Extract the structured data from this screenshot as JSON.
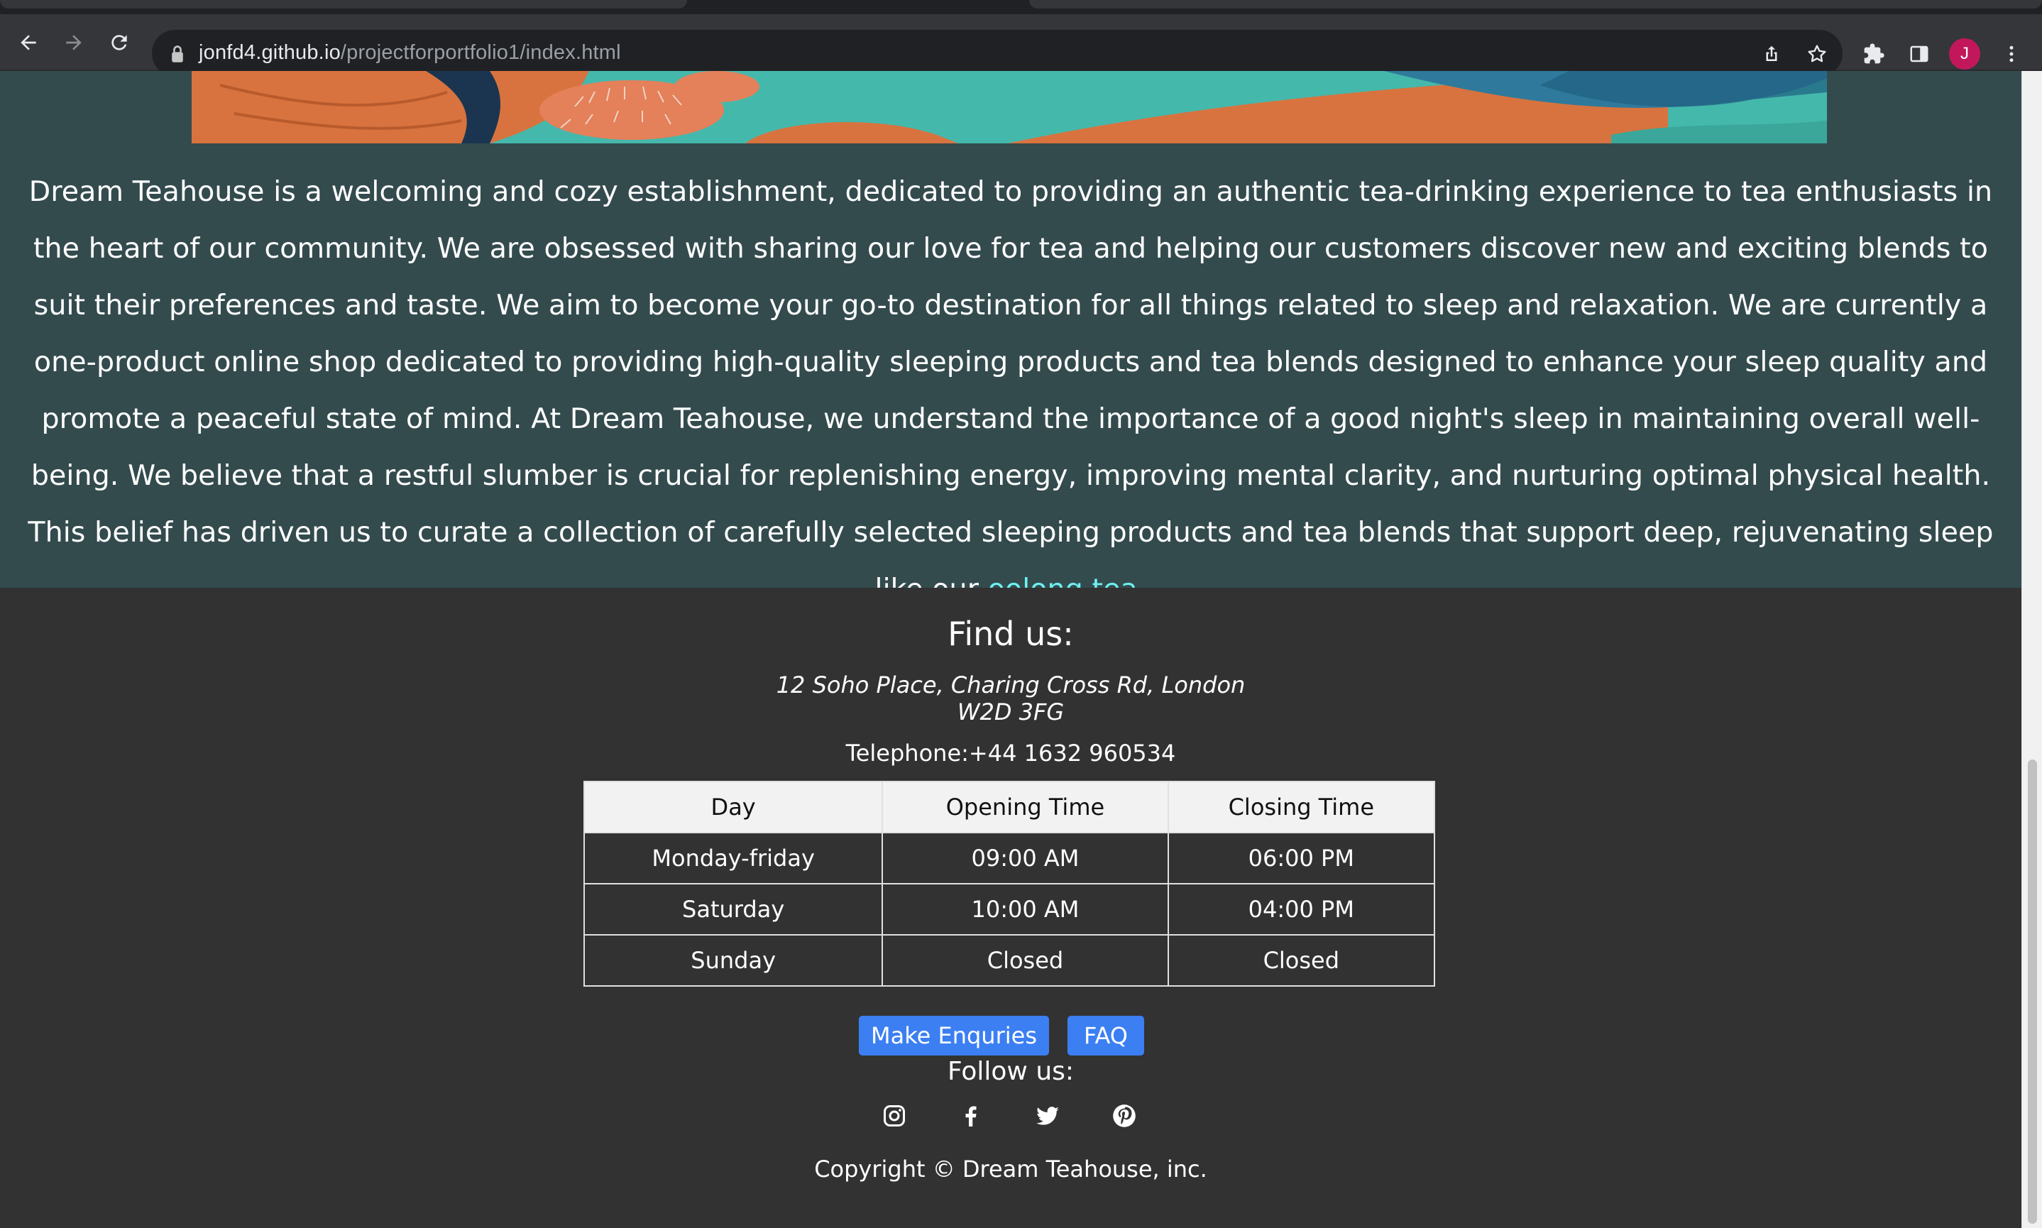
{
  "browser": {
    "url_domain": "jonfd4.github.io",
    "url_path": "/projectforportfolio1/index.html",
    "profile_initial": "J",
    "icons": [
      "back-icon",
      "forward-icon",
      "reload-icon",
      "lock-icon",
      "share-icon",
      "bookmark-star-icon",
      "extensions-icon",
      "side-panel-icon",
      "menu-icon"
    ]
  },
  "about": {
    "paragraph": "Dream Teahouse is a welcoming and cozy establishment, dedicated to providing an authentic tea-drinking experience to tea enthusiasts in the heart of our community. We are obsessed with sharing our love for tea and helping our customers discover new and exciting blends to suit their preferences and taste. We aim to become your go-to destination for all things related to sleep and relaxation. We are currently a one-product online shop dedicated to providing high-quality sleeping products and tea blends designed to enhance your sleep quality and promote a peaceful state of mind. At Dream Teahouse, we understand the importance of a good night's sleep in maintaining overall well-being. We believe that a restful slumber is crucial for replenishing energy, improving mental clarity, and nurturing optimal physical health. This belief has driven us to curate a collection of carefully selected sleeping products and tea blends that support deep, rejuvenating sleep like our ",
    "link_text": "oolong tea",
    "end": ".",
    "link_color": "#6ef1f2"
  },
  "footer": {
    "find_title": "Find us:",
    "address_line1": "12 Soho Place, Charing Cross Rd, London",
    "address_line2": "W2D 3FG",
    "phone": "Telephone:+44 1632 960534",
    "table": {
      "headers": [
        "Day",
        "Opening Time",
        "Closing Time"
      ],
      "rows": [
        [
          "Monday-friday",
          "09:00 AM",
          "06:00 PM"
        ],
        [
          "Saturday",
          "10:00 AM",
          "04:00 PM"
        ],
        [
          "Sunday",
          "Closed",
          "Closed"
        ]
      ]
    },
    "enquiries_button": "Make Enquries",
    "faq_button": "FAQ",
    "button_color": "#3b7ff2",
    "follow_title": "Follow us:",
    "social_icons": [
      "instagram-icon",
      "facebook-icon",
      "twitter-icon",
      "pinterest-icon"
    ],
    "copyright": "Copyright © Dream Teahouse, inc."
  }
}
